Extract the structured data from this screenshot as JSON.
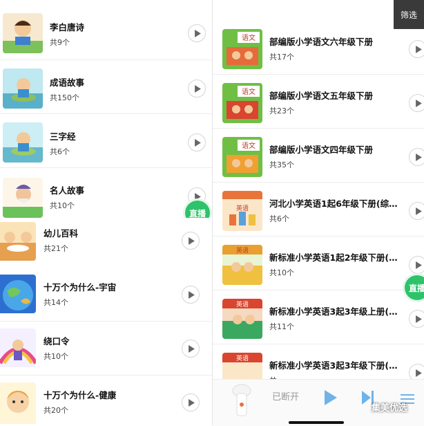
{
  "left_top": {
    "items": [
      {
        "title": "李白唐诗",
        "count": "共9个",
        "icon": "boy-reading-book-thumbnail"
      },
      {
        "title": "成语故事",
        "count": "共150个",
        "icon": "boy-on-rock-thumbnail"
      },
      {
        "title": "三字经",
        "count": "共6个",
        "icon": "boy-on-rock-thumbnail"
      },
      {
        "title": "名人故事",
        "count": "共10个",
        "icon": "old-man-thumbnail"
      }
    ]
  },
  "left_bottom": {
    "items": [
      {
        "title": "幼儿百科",
        "count": "共21个",
        "icon": "kids-at-table-thumbnail"
      },
      {
        "title": "十万个为什么-宇宙",
        "count": "共14个",
        "icon": "earth-cartoon-thumbnail"
      },
      {
        "title": "绕口令",
        "count": "共10个",
        "icon": "girl-rainbow-thumbnail"
      },
      {
        "title": "十万个为什么-健康",
        "count": "共20个",
        "icon": "girl-face-thumbnail"
      }
    ]
  },
  "right": {
    "filter_label": "筛选",
    "items": [
      {
        "title": "部编版小学语文六年级下册",
        "count": "共17个",
        "icon": "chinese-textbook-thumbnail"
      },
      {
        "title": "部编版小学语文五年级下册",
        "count": "共23个",
        "icon": "chinese-textbook-thumbnail"
      },
      {
        "title": "部编版小学语文四年级下册",
        "count": "共35个",
        "icon": "chinese-textbook-thumbnail"
      },
      {
        "title": "河北小学英语1起6年级下册(综合...",
        "count": "共6个",
        "icon": "english-textbook-thumbnail"
      },
      {
        "title": "新标准小学英语1起2年级下册(综...",
        "count": "共10个",
        "icon": "english-textbook-thumbnail"
      },
      {
        "title": "新标准小学英语3起3年级上册(综...",
        "count": "共11个",
        "icon": "english-textbook-thumbnail"
      },
      {
        "title": "新标准小学英语3起3年级下册(综...",
        "count": "共",
        "icon": "english-textbook-thumbnail"
      }
    ]
  },
  "live_badge": "直播",
  "player": {
    "status": "已断开"
  },
  "watermark": "集美优选",
  "colors": {
    "live": "#2ec36a",
    "play_accent": "#6fb3e8",
    "filter_bg": "#3a3a3a"
  }
}
